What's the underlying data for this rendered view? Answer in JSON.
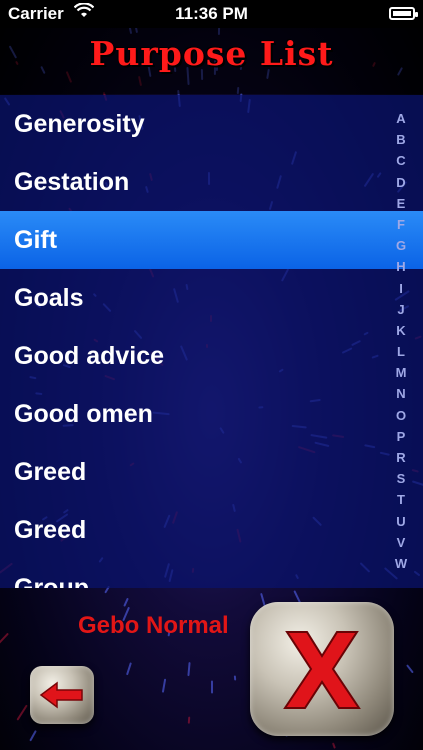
{
  "status_bar": {
    "carrier": "Carrier",
    "time": "11:36 PM"
  },
  "title": "Purpose List",
  "list": {
    "items": [
      {
        "label": "Generosity",
        "selected": false
      },
      {
        "label": "Gestation",
        "selected": false
      },
      {
        "label": "Gift",
        "selected": true
      },
      {
        "label": "Goals",
        "selected": false
      },
      {
        "label": "Good advice",
        "selected": false
      },
      {
        "label": "Good omen",
        "selected": false
      },
      {
        "label": "Greed",
        "selected": false
      },
      {
        "label": "Greed",
        "selected": false
      },
      {
        "label": "Group",
        "selected": false
      }
    ]
  },
  "index_letters": [
    "A",
    "B",
    "C",
    "D",
    "E",
    "F",
    "G",
    "H",
    "I",
    "J",
    "K",
    "L",
    "M",
    "N",
    "O",
    "P",
    "R",
    "S",
    "T",
    "U",
    "V",
    "W"
  ],
  "bottom": {
    "mode_label": "Gebo Normal"
  },
  "colors": {
    "title": "#ff1a1a",
    "selected_row": "#1a74ee",
    "mode_label": "#e21616"
  },
  "icons": {
    "back": "left-arrow-icon",
    "cancel": "x-icon"
  }
}
